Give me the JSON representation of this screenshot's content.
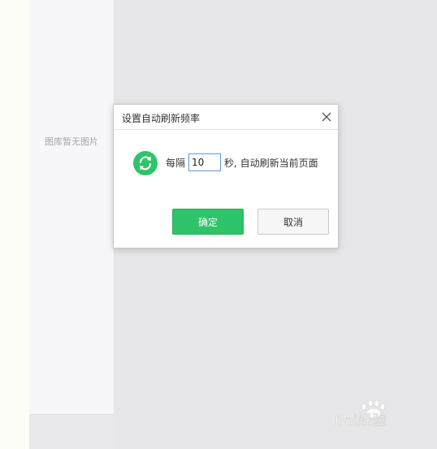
{
  "gallery": {
    "empty_text": "图库暂无图片"
  },
  "dialog": {
    "title": "设置自动刷新频率",
    "interval_prefix": "每隔",
    "interval_value": "10",
    "interval_suffix": "秒, 自动刷新当前页面",
    "ok_label": "确定",
    "cancel_label": "取消"
  },
  "watermark": {
    "text": "Bai经验"
  },
  "colors": {
    "accent_green": "#2fc46a",
    "input_border": "#5b9bd5",
    "background": "#e8e7e9"
  },
  "icons": {
    "close": "close-icon",
    "refresh": "refresh-icon"
  }
}
